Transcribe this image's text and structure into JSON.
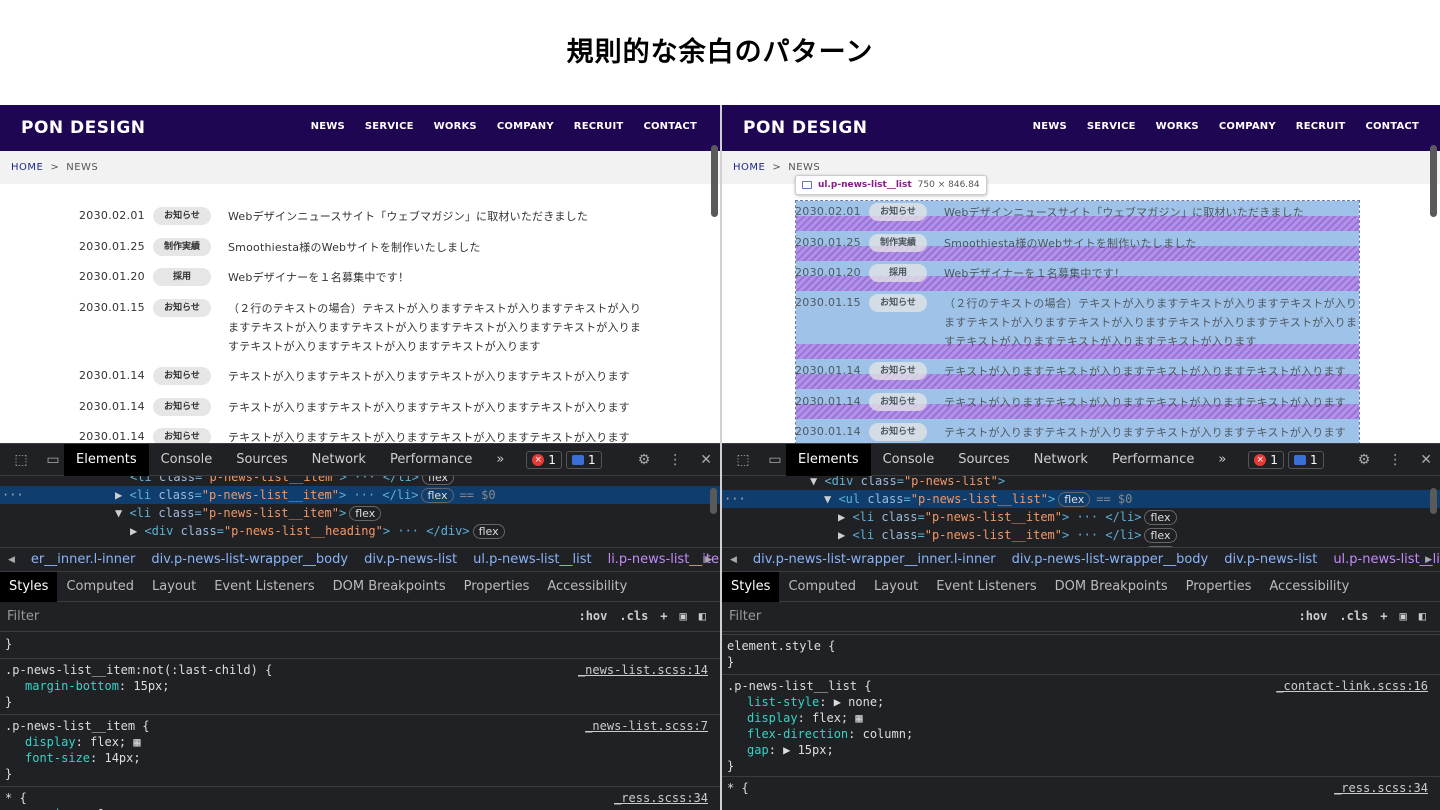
{
  "title": "規則的な余白のパターン",
  "site": {
    "logo": "PON DESIGN",
    "nav": [
      "NEWS",
      "SERVICE",
      "WORKS",
      "COMPANY",
      "RECRUIT",
      "CONTACT"
    ],
    "breadcrumb": {
      "home": "HOME",
      "sep": ">",
      "current": "NEWS"
    },
    "news": [
      {
        "date": "2030.02.01",
        "badge": "お知らせ",
        "lines": [
          "Webデザインニュースサイト「ウェブマガジン」に取材いただきました"
        ]
      },
      {
        "date": "2030.01.25",
        "badge": "制作実績",
        "lines": [
          "Smoothiesta様のWebサイトを制作いたしました"
        ]
      },
      {
        "date": "2030.01.20",
        "badge": "採用",
        "lines": [
          "Webデザイナーを１名募集中です！"
        ]
      },
      {
        "date": "2030.01.15",
        "badge": "お知らせ",
        "lines": [
          "（２行のテキストの場合）テキストが入りますテキストが入りますテキストが入り",
          "ますテキストが入りますテキストが入りますテキストが入りますテキストが入りま",
          "すテキストが入りますテキストが入りますテキストが入ります"
        ]
      },
      {
        "date": "2030.01.14",
        "badge": "お知らせ",
        "lines": [
          "テキストが入りますテキストが入りますテキストが入りますテキストが入ります"
        ]
      },
      {
        "date": "2030.01.14",
        "badge": "お知らせ",
        "lines": [
          "テキストが入りますテキストが入りますテキストが入りますテキストが入ります"
        ]
      },
      {
        "date": "2030.01.14",
        "badge": "お知らせ",
        "lines": [
          "テキストが入りますテキストが入りますテキストが入りますテキストが入ります"
        ]
      }
    ],
    "news_right_lines_row4": [
      "（２行のテキストの場合）テキストが入りますテキストが入りますテキストが入り",
      "ますテキストが入りますテキストが入りますテキストが入りますテキストが入りま",
      "すテキストが入りますテキストが入りますテキストが入ります"
    ]
  },
  "tooltip": {
    "selector": "ul.p-news-list__list",
    "size": "750 × 846.84"
  },
  "devtools": {
    "tabs": [
      "Elements",
      "Console",
      "Sources",
      "Network",
      "Performance",
      "»"
    ],
    "errors": "1",
    "messages": "1",
    "subtabs": [
      "Styles",
      "Computed",
      "Layout",
      "Event Listeners",
      "DOM Breakpoints",
      "Properties",
      "Accessibility"
    ],
    "filter": "Filter",
    "hov": ":hov",
    "cls": ".cls",
    "left": {
      "dom": [
        {
          "tri": "",
          "open": "<li class=\"p-news-list__item\">",
          "mid": " ··· </li>",
          "pill": "flex"
        },
        {
          "tri": "▶",
          "open": "<li class=\"p-news-list__item\">",
          "mid": " ··· </li>",
          "pill": "flex",
          "eq": "== $0"
        },
        {
          "tri": "▼",
          "open": "<li class=\"p-news-list__item\">",
          "mid": "",
          "pill": "flex"
        },
        {
          "tri": "▶",
          "open": "<div class=\"p-news-list__heading\">",
          "mid": " ··· </div>",
          "pill": "flex"
        }
      ],
      "crumbs": [
        "◀",
        "er__inner.l-inner",
        "div.p-news-list-wrapper__body",
        "div.p-news-list",
        "ul.p-news-list__list",
        "li.p-news-list__item",
        "▶"
      ],
      "rules": {
        "r1": {
          "sel": ".p-news-list__item:not(:last-child) {",
          "src": "_news-list.scss:14",
          "props": [
            [
              "margin-bottom",
              ": 15px;"
            ]
          ]
        },
        "r2": {
          "sel": ".p-news-list__item {",
          "src": "_news-list.scss:7",
          "props": [
            [
              "display",
              ": flex;"
            ],
            [
              "font-size",
              ": 14px;"
            ]
          ]
        },
        "r3": {
          "sel": "* {",
          "src": "_ress.scss:34",
          "props": [
            [
              "margin",
              ": ▶ 0;"
            ]
          ]
        }
      }
    },
    "right": {
      "dom": [
        {
          "tri": "▼",
          "open": "<div class=\"p-news-list\">",
          "mid": "",
          "pill": ""
        },
        {
          "tri": "▼",
          "open": "<ul class=\"p-news-list__list\">",
          "mid": "",
          "pill": "flex",
          "eq": "== $0"
        },
        {
          "tri": "▶",
          "open": "<li class=\"p-news-list__item\">",
          "mid": " ··· </li>",
          "pill": "flex"
        },
        {
          "tri": "▶",
          "open": "<li class=\"p-news-list__item\">",
          "mid": " ··· </li>",
          "pill": "flex"
        },
        {
          "tri": "▶",
          "open": "<li class=\"p-news-list__item\">",
          "mid": " ··· </li>",
          "pill": "flex"
        }
      ],
      "crumbs": [
        "◀",
        "div.p-news-list-wrapper__inner.l-inner",
        "div.p-news-list-wrapper__body",
        "div.p-news-list",
        "ul.p-news-list__list",
        "▶"
      ],
      "rules": {
        "r0": {
          "sel": "element.style {",
          "src": "",
          "props": []
        },
        "r1": {
          "sel": ".p-news-list__list {",
          "src": "_contact-link.scss:16",
          "props": [
            [
              "list-style",
              ": ▶ none;"
            ],
            [
              "display",
              ": flex;"
            ],
            [
              "flex-direction",
              ": column;"
            ],
            [
              "gap",
              ": ▶ 15px;"
            ]
          ]
        },
        "r2": {
          "sel": "* {",
          "src": "_ress.scss:34",
          "props": []
        }
      }
    }
  }
}
